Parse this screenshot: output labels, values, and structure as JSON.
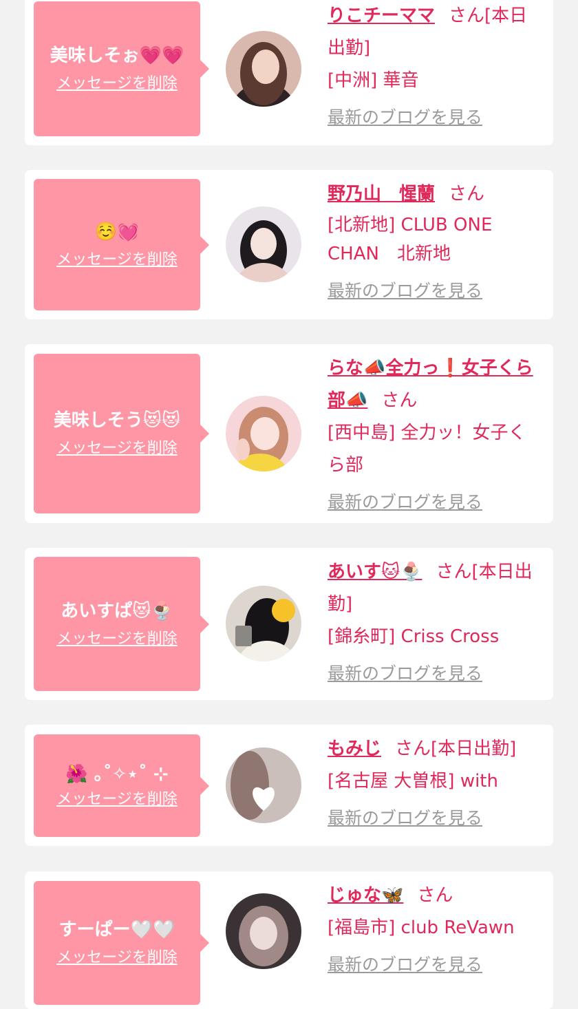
{
  "colors": {
    "page_background": "#f2f2f2",
    "card_background": "#ffffff",
    "bubble_background": "#ff96a6",
    "name_text": "#e0295a",
    "blog_link_text": "#9a9a9a"
  },
  "delete_label": "メッセージを削除",
  "blog_label": "最新のブログを見る",
  "items": [
    {
      "message": "美味しそぉ💗💗",
      "name": "りこチーママ",
      "suffix": "さん[本日出勤]",
      "shop": "[中洲] 華音",
      "avatar_icon": "avatar-photo-icon"
    },
    {
      "message": "☺️💓",
      "name": "野乃山　惺蘭",
      "suffix": "さん",
      "shop": "[北新地] CLUB ONE CHAN　北新地",
      "avatar_icon": "avatar-photo-icon"
    },
    {
      "message": "美味しそう😻😻",
      "name": "らな📣全力っ❗️女子くら部📣",
      "suffix": "さん",
      "shop": "[西中島] 全力ッ！女子くら部",
      "avatar_icon": "avatar-photo-icon"
    },
    {
      "message": "あいすぱ😻🍨",
      "name": "あいす🐱🍨",
      "suffix": "さん[本日出勤]",
      "shop": "[錦糸町] Criss Cross",
      "avatar_icon": "avatar-photo-icon"
    },
    {
      "message": "🌺 ｡˚✧⋆˚ ⊹",
      "name": "もみじ",
      "suffix": "さん[本日出勤]",
      "shop": "[名古屋 大曽根] with",
      "avatar_icon": "avatar-photo-icon"
    },
    {
      "message": "すーぱー🤍🤍",
      "name": "じゅな🦋",
      "suffix": "さん",
      "shop": "[福島市] club ReVawn",
      "avatar_icon": "avatar-photo-icon"
    }
  ]
}
